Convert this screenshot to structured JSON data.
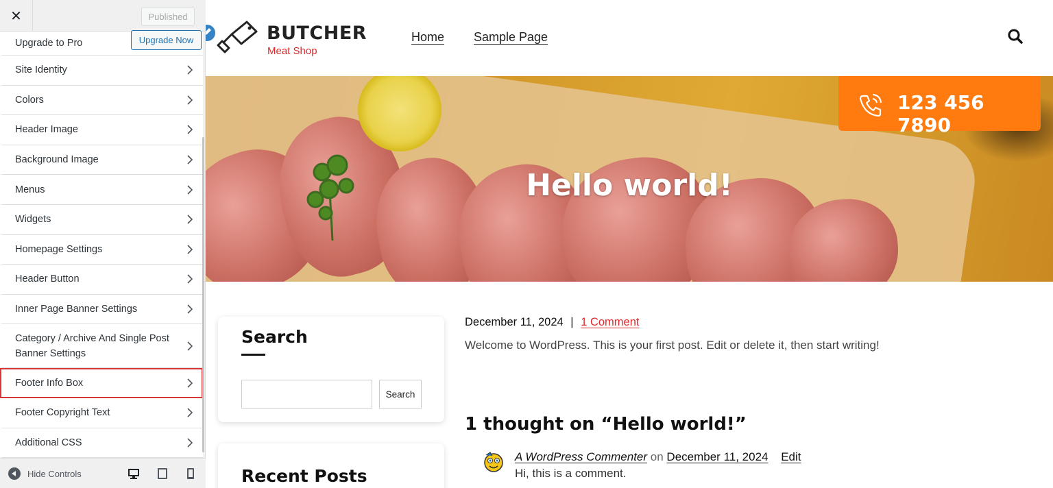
{
  "sidebar": {
    "close_label": "✕",
    "published_label": "Published",
    "upgrade": {
      "label": "Upgrade to Pro",
      "button": "Upgrade Now"
    },
    "items": [
      {
        "label": "Site Identity"
      },
      {
        "label": "Colors"
      },
      {
        "label": "Header Image"
      },
      {
        "label": "Background Image"
      },
      {
        "label": "Menus"
      },
      {
        "label": "Widgets"
      },
      {
        "label": "Homepage Settings"
      },
      {
        "label": "Header Button"
      },
      {
        "label": "Inner Page Banner Settings"
      },
      {
        "label": "Category / Archive And Single Post Banner Settings"
      },
      {
        "label": "Footer Info Box"
      },
      {
        "label": "Footer Copyright Text"
      },
      {
        "label": "Additional CSS"
      }
    ],
    "active_item": "Footer Info Box",
    "footer": {
      "hide_controls": "Hide Controls",
      "devices": [
        "desktop-icon",
        "tablet-icon",
        "mobile-icon"
      ],
      "active_device": "desktop"
    }
  },
  "site": {
    "logo": {
      "title": "BUTCHER",
      "subtitle": "Meat Shop",
      "icon": "cleaver-icon"
    },
    "nav": [
      "Home",
      "Sample Page"
    ],
    "hero": {
      "title": "Hello world!",
      "phone": "123 456 7890"
    },
    "colors": {
      "accent": "#ff7a0f",
      "brand_red": "#e0282b"
    },
    "widgets": {
      "search": {
        "title": "Search",
        "button": "Search"
      },
      "recent": {
        "title": "Recent Posts"
      }
    },
    "post": {
      "date": "December 11, 2024",
      "separator": "|",
      "comments_link": "1 Comment",
      "excerpt": "Welcome to WordPress. This is your first post. Edit or delete it, then start writing!"
    },
    "comments": {
      "title": "1 thought on “Hello world!”",
      "author": "A WordPress Commenter",
      "on": "on",
      "date": "December 11, 2024",
      "edit": "Edit",
      "text": "Hi, this is a comment."
    }
  }
}
